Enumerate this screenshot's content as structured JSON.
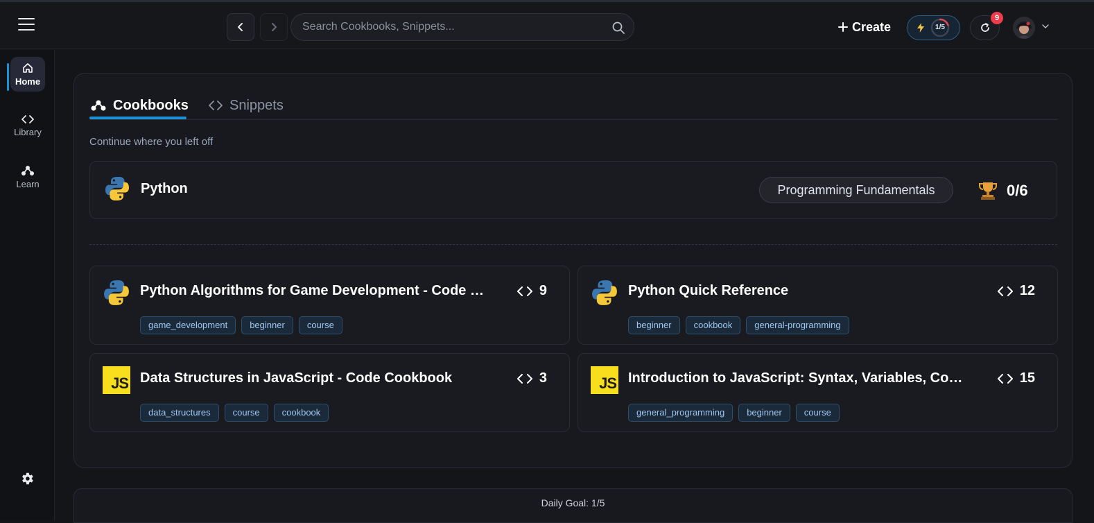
{
  "header": {
    "search_placeholder": "Search Cookbooks, Snippets...",
    "create_label": "Create",
    "goal_progress_label": "1/5",
    "goal_progress": 0.2,
    "notification_count": "9"
  },
  "sidebar": {
    "items": [
      {
        "label": "Home",
        "icon": "home-icon",
        "active": true
      },
      {
        "label": "Library",
        "icon": "code-icon"
      },
      {
        "label": "Learn",
        "icon": "learn-nodes-icon"
      }
    ]
  },
  "tabs": [
    {
      "label": "Cookbooks",
      "active": true
    },
    {
      "label": "Snippets"
    }
  ],
  "continue": {
    "heading": "Continue where you left off",
    "title": "Python",
    "category": "Programming Fundamentals",
    "score": "0/6"
  },
  "cookbooks": [
    {
      "title": "Python Algorithms for Game Development - Code Cookbook",
      "count": "9",
      "lang": "python",
      "tags": [
        "game_development",
        "beginner",
        "course"
      ]
    },
    {
      "title": "Python Quick Reference",
      "count": "12",
      "lang": "python",
      "tags": [
        "beginner",
        "cookbook",
        "general-programming"
      ]
    },
    {
      "title": "Data Structures in JavaScript - Code Cookbook",
      "count": "3",
      "lang": "javascript",
      "tags": [
        "data_structures",
        "course",
        "cookbook"
      ]
    },
    {
      "title": "Introduction to JavaScript: Syntax, Variables, Control Flow",
      "count": "15",
      "lang": "javascript",
      "tags": [
        "general_programming",
        "beginner",
        "course"
      ]
    }
  ],
  "js_logo_text": "JS",
  "footer": {
    "daily_goal": "Daily Goal: 1/5"
  },
  "colors": {
    "accent": "#1e90d6",
    "badge": "#ef3b4a",
    "tag_text": "#9fc6ef"
  }
}
